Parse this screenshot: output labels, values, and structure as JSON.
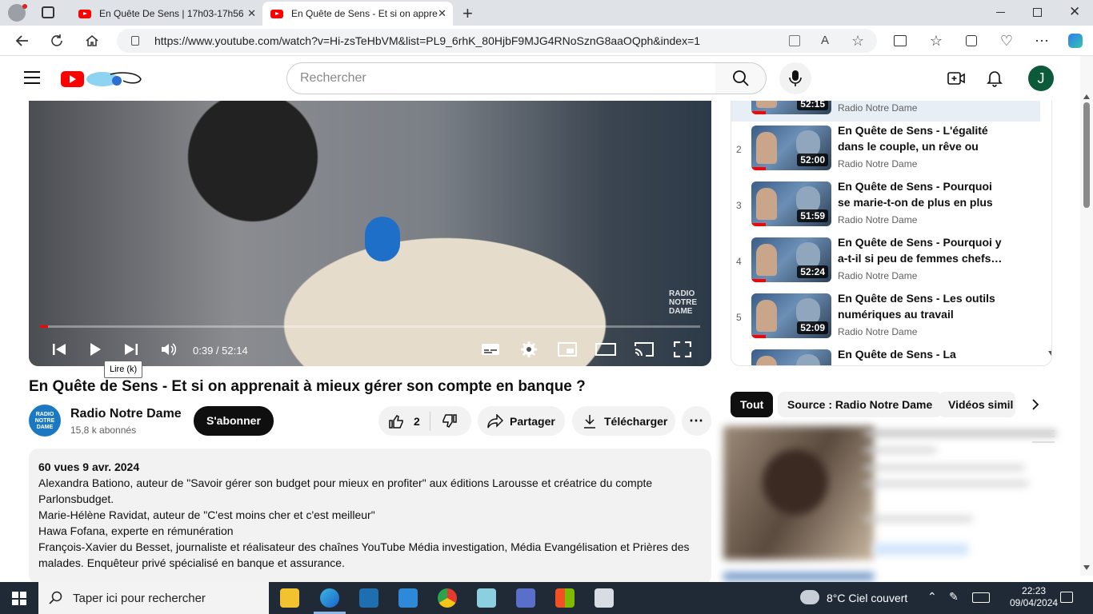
{
  "browser": {
    "tabs": [
      {
        "title": "En Quête De Sens | 17h03-17h56"
      },
      {
        "title": "En Quête de Sens - Et si on appre"
      }
    ],
    "url": "https://www.youtube.com/watch?v=Hi-zsTeHbVM&list=PL9_6rhK_80HjbF9MJG4RNoSznG8aaOQph&index=1"
  },
  "youtube": {
    "search_placeholder": "Rechercher",
    "avatar_letter": "J"
  },
  "player": {
    "time": "0:39 / 52:14",
    "progress_fraction": 0.0125,
    "tooltip": "Lire (k)",
    "watermark": "RADIO NOTRE DAME"
  },
  "video": {
    "title": "En Quête de Sens - Et si on apprenait à mieux gérer son compte en banque ?",
    "channel": "Radio Notre Dame",
    "channel_logo_text": "RADIO NOTRE DAME",
    "subscribers": "15,8 k abonnés",
    "subscribe_label": "S'abonner",
    "likes": "2",
    "share_label": "Partager",
    "download_label": "Télécharger"
  },
  "description": {
    "meta": "60 vues  9 avr. 2024",
    "lines": [
      "Alexandra Bationo, auteur de \"Savoir gérer son budget pour mieux en profiter\" aux éditions Larousse et créatrice du compte Parlonsbudget.",
      "Marie-Hélène Ravidat, auteur de \"C'est moins cher et c'est meilleur\"",
      "Hawa Fofana, experte en rémunération",
      "François-Xavier du Besset, journaliste et réalisateur des chaînes YouTube Média investigation, Média Evangélisation et Prières des malades. Enquêteur privé spécialisé en banque et assurance."
    ]
  },
  "playlist": {
    "items": [
      {
        "index": "",
        "title": "",
        "channel": "Radio Notre Dame",
        "duration": "52:15"
      },
      {
        "index": "2",
        "title": "En Quête de Sens - L'égalité dans le couple, un rêve ou un…",
        "channel": "Radio Notre Dame",
        "duration": "52:00"
      },
      {
        "index": "3",
        "title": "En Quête de Sens - Pourquoi se marie-t-on de plus en plus tar…",
        "channel": "Radio Notre Dame",
        "duration": "51:59"
      },
      {
        "index": "4",
        "title": "En Quête de Sens - Pourquoi y a-t-il si peu de femmes chefs…",
        "channel": "Radio Notre Dame",
        "duration": "52:24"
      },
      {
        "index": "5",
        "title": "En Quête de Sens - Les outils numériques au travail risquen…",
        "channel": "Radio Notre Dame",
        "duration": "52:09"
      },
      {
        "index": "",
        "title": "En Quête de Sens - La",
        "channel": "",
        "duration": ""
      }
    ]
  },
  "chips": [
    "Tout",
    "Source : Radio Notre Dame",
    "Vidéos simil"
  ],
  "taskbar": {
    "search_placeholder": "Taper ici pour rechercher",
    "weather": "8°C  Ciel couvert",
    "time": "22:23",
    "date": "09/04/2024"
  },
  "colors": {
    "youtube_red": "#ff0000",
    "taskbar": "#1f2a36",
    "avatar": "#0b5a3a"
  }
}
